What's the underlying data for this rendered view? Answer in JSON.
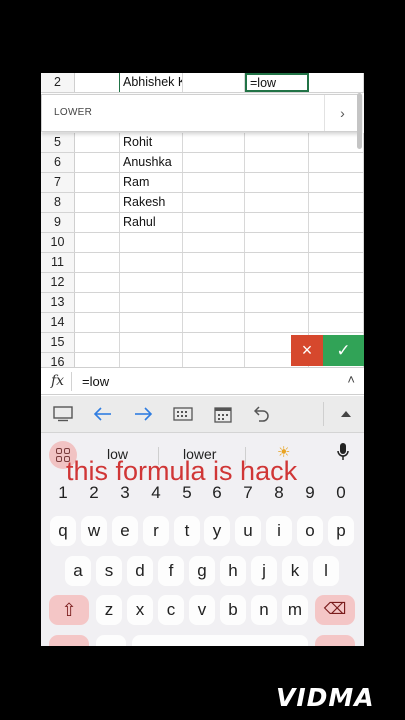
{
  "rows": [
    {
      "num": "2",
      "b": "Abhishek Kumar",
      "d": "=low",
      "active": true
    },
    {
      "num": "5",
      "b": "Rohit"
    },
    {
      "num": "6",
      "b": "Anushka"
    },
    {
      "num": "7",
      "b": "Ram"
    },
    {
      "num": "8",
      "b": "Rakesh"
    },
    {
      "num": "9",
      "b": "Rahul"
    },
    {
      "num": "10",
      "b": ""
    },
    {
      "num": "11",
      "b": ""
    },
    {
      "num": "12",
      "b": ""
    },
    {
      "num": "13",
      "b": ""
    },
    {
      "num": "14",
      "b": ""
    },
    {
      "num": "15",
      "b": ""
    },
    {
      "num": "16",
      "b": ""
    }
  ],
  "autocomplete": {
    "label": "LOWER",
    "chevron": "›"
  },
  "actions": {
    "cancel": "×",
    "confirm": "✓"
  },
  "formula_bar": {
    "fx": "fx",
    "value": "=low",
    "caret": "˄"
  },
  "toolbar": {
    "icons": [
      "keyboard-icon",
      "arrow-left-icon",
      "arrow-right-icon",
      "numeric-keyboard-icon",
      "calendar-icon",
      "undo-icon",
      "expand-up-icon"
    ]
  },
  "keyboard": {
    "suggestions": [
      "low",
      "lower"
    ],
    "overlay_text": "this formula is hack",
    "number_row": [
      "1",
      "2",
      "3",
      "4",
      "5",
      "6",
      "7",
      "8",
      "9",
      "0"
    ],
    "row1": [
      "q",
      "w",
      "e",
      "r",
      "t",
      "y",
      "u",
      "i",
      "o",
      "p"
    ],
    "row2": [
      "a",
      "s",
      "d",
      "f",
      "g",
      "h",
      "j",
      "k",
      "l"
    ],
    "row3": [
      "z",
      "x",
      "c",
      "v",
      "b",
      "n",
      "m"
    ],
    "shift": "⇧",
    "backspace": "⌫"
  },
  "watermark": "VIDMA",
  "colors": {
    "accent_green": "#217346",
    "confirm_green": "#31a357",
    "cancel_red": "#d6482d",
    "overlay_red": "#d03636"
  }
}
